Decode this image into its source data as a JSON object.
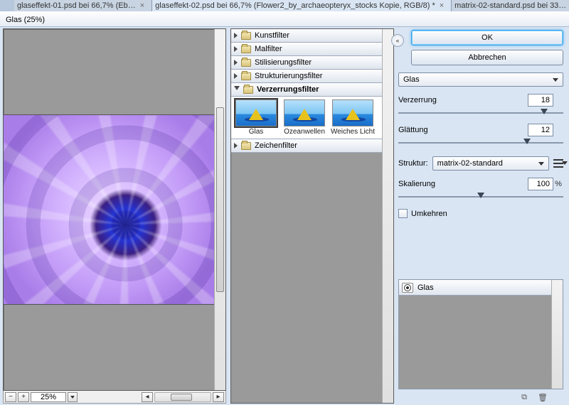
{
  "tabs": [
    {
      "label": "glaseffekt-01.psd bei 66,7% (Eb…"
    },
    {
      "label": "glaseffekt-02.psd bei 66,7% (Flower2_by_archaeopteryx_stocks Kopie, RGB/8) *",
      "active": true
    },
    {
      "label": "matrix-02-standard.psd bei 33…"
    }
  ],
  "dialog_title": "Glas (25%)",
  "preview": {
    "zoom": "25%"
  },
  "categories": [
    {
      "name": "Kunstfilter",
      "open": false
    },
    {
      "name": "Malfilter",
      "open": false
    },
    {
      "name": "Stilisierungsfilter",
      "open": false
    },
    {
      "name": "Strukturierungsfilter",
      "open": false
    },
    {
      "name": "Verzerrungsfilter",
      "open": true,
      "items": [
        {
          "label": "Glas",
          "selected": true
        },
        {
          "label": "Ozeanwellen"
        },
        {
          "label": "Weiches Licht"
        }
      ]
    },
    {
      "name": "Zeichenfilter",
      "open": false
    }
  ],
  "buttons": {
    "ok": "OK",
    "cancel": "Abbrechen"
  },
  "filter_select": "Glas",
  "params": {
    "distortion": {
      "label": "Verzerrung",
      "value": "18",
      "pos": 86
    },
    "smooth": {
      "label": "Glättung",
      "value": "12",
      "pos": 76
    },
    "texture": {
      "label": "Struktur:",
      "value": "matrix-02-standard"
    },
    "scale": {
      "label": "Skalierung",
      "value": "100",
      "unit": "%",
      "pos": 48
    },
    "invert": {
      "label": "Umkehren"
    }
  },
  "layers": {
    "active": "Glas"
  },
  "collapse_glyph": "«",
  "icons": {
    "new_layer": "⧉",
    "trash": "🗑"
  }
}
